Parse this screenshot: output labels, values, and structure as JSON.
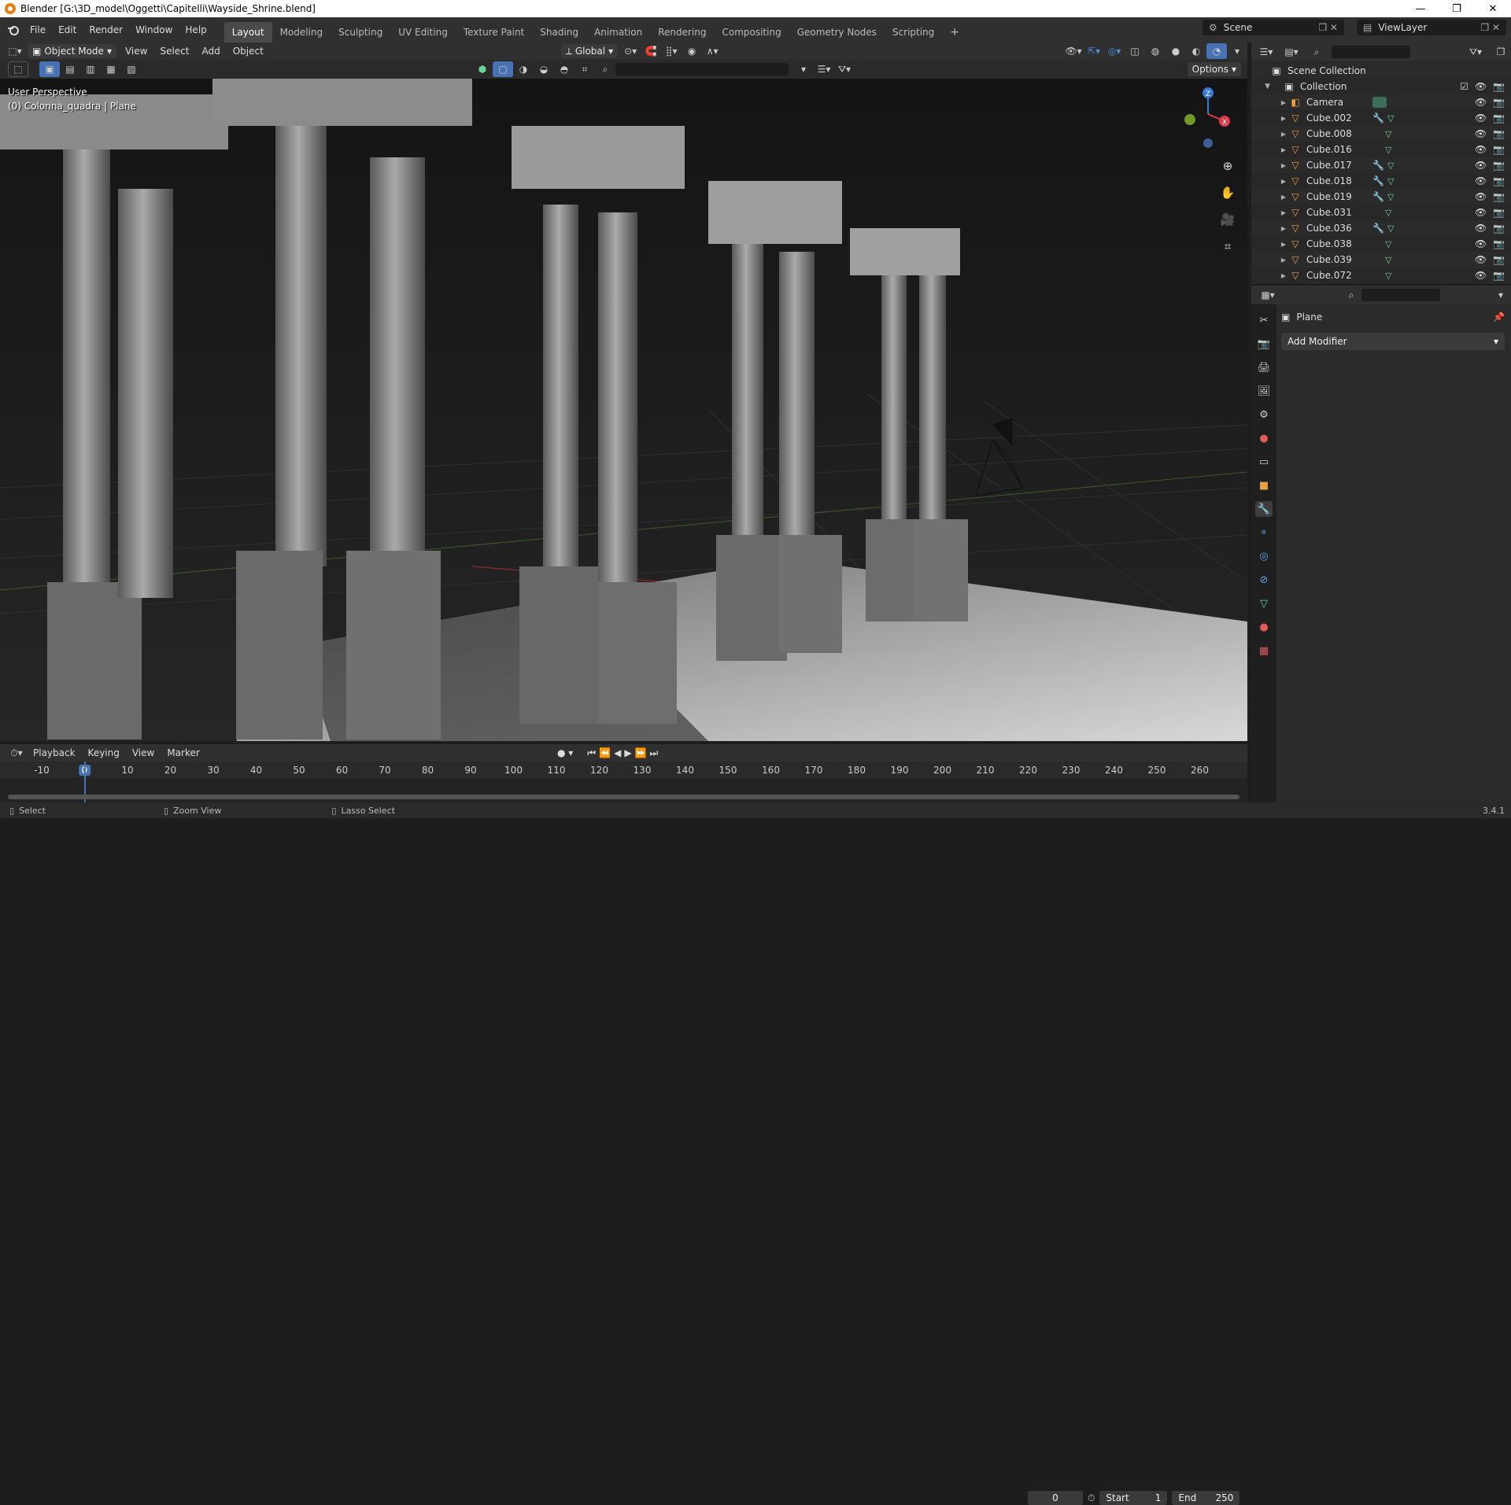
{
  "window": {
    "title": "Blender [G:\\3D_model\\Oggetti\\Capitelli\\Wayside_Shrine.blend]",
    "min": "—",
    "max": "❐",
    "close": "✕"
  },
  "menu": [
    "File",
    "Edit",
    "Render",
    "Window",
    "Help"
  ],
  "workspaces": {
    "active": "Layout",
    "tabs": [
      "Modeling",
      "Sculpting",
      "UV Editing",
      "Texture Paint",
      "Shading",
      "Animation",
      "Rendering",
      "Compositing",
      "Geometry Nodes",
      "Scripting"
    ],
    "add": "+"
  },
  "scene": {
    "name": "Scene",
    "view_layer": "ViewLayer"
  },
  "viewport_header": {
    "mode": "Object Mode",
    "menus": [
      "View",
      "Select",
      "Add",
      "Object"
    ],
    "orientation": "Global",
    "options": "Options"
  },
  "viewport": {
    "perspective": "User Perspective",
    "active_object": "(0) Colonna_quadra | Plane",
    "axes": {
      "z": "Z",
      "x": "X"
    }
  },
  "outliner": {
    "scene_collection": "Scene Collection",
    "collection": "Collection",
    "items": [
      {
        "name": "Camera",
        "type": "camera",
        "modifier": false
      },
      {
        "name": "Cube.002",
        "type": "mesh",
        "modifier": true
      },
      {
        "name": "Cube.008",
        "type": "mesh",
        "modifier": false
      },
      {
        "name": "Cube.016",
        "type": "mesh",
        "modifier": false
      },
      {
        "name": "Cube.017",
        "type": "mesh",
        "modifier": true
      },
      {
        "name": "Cube.018",
        "type": "mesh",
        "modifier": true
      },
      {
        "name": "Cube.019",
        "type": "mesh",
        "modifier": true
      },
      {
        "name": "Cube.031",
        "type": "mesh",
        "modifier": false
      },
      {
        "name": "Cube.036",
        "type": "mesh",
        "modifier": true
      },
      {
        "name": "Cube.038",
        "type": "mesh",
        "modifier": false
      },
      {
        "name": "Cube.039",
        "type": "mesh",
        "modifier": false
      },
      {
        "name": "Cube.072",
        "type": "mesh",
        "modifier": false
      }
    ]
  },
  "properties": {
    "object_name": "Plane",
    "add_modifier": "Add Modifier"
  },
  "timeline": {
    "menus": [
      "Playback",
      "Keying",
      "View",
      "Marker"
    ],
    "current_frame": "0",
    "start_label": "Start",
    "start": "1",
    "end_label": "End",
    "end": "250",
    "ruler": [
      "-10",
      "0",
      "10",
      "20",
      "30",
      "40",
      "50",
      "60",
      "70",
      "80",
      "90",
      "100",
      "110",
      "120",
      "130",
      "140",
      "150",
      "160",
      "170",
      "180",
      "190",
      "200",
      "210",
      "220",
      "230",
      "240",
      "250",
      "260"
    ]
  },
  "status": {
    "select": "Select",
    "zoom": "Zoom View",
    "lasso": "Lasso Select",
    "version": "3.4.1"
  }
}
